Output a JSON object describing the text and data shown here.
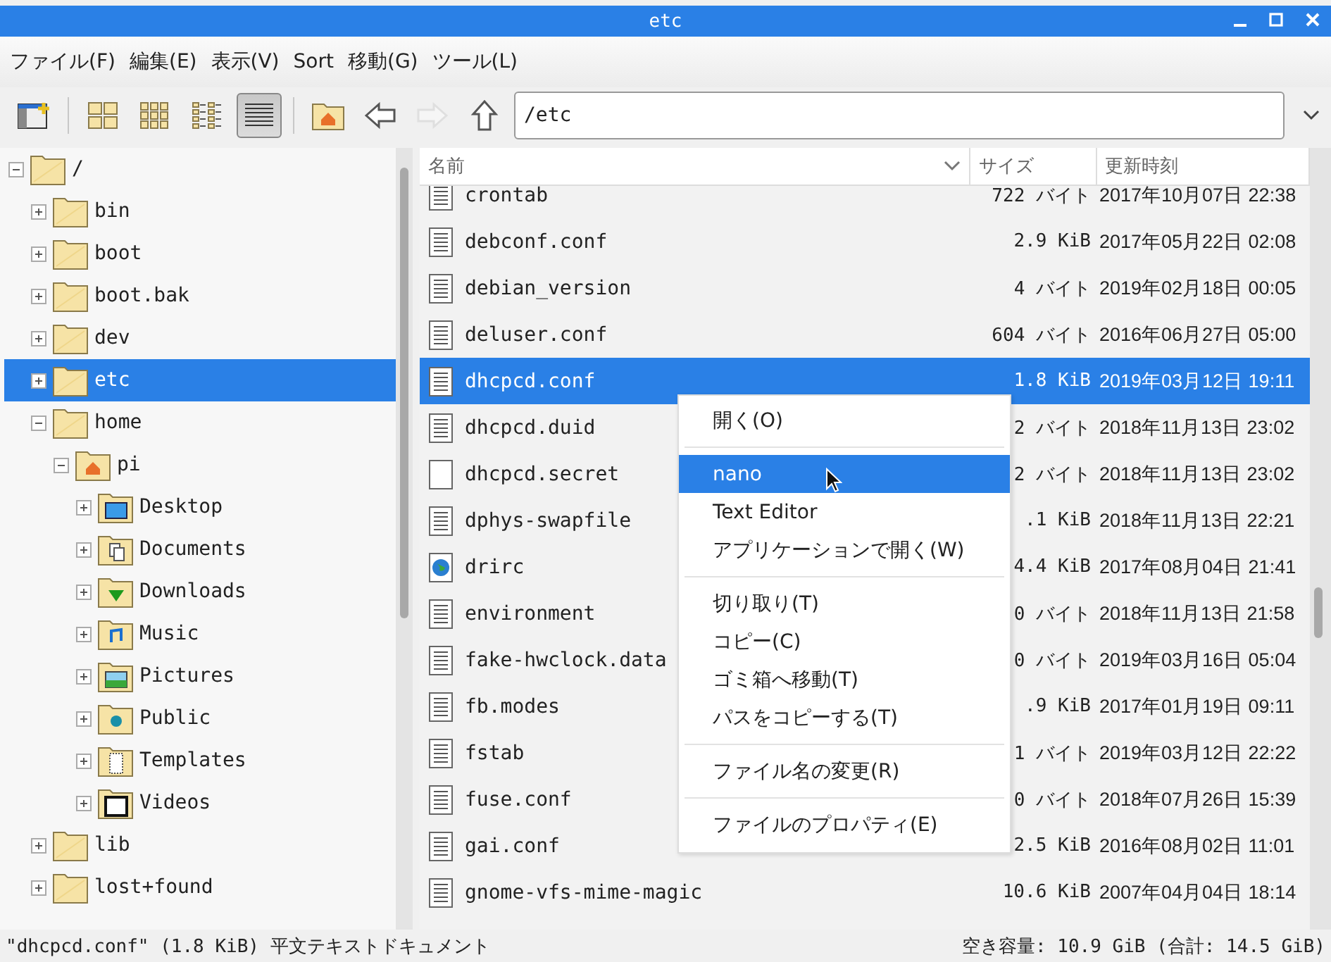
{
  "window": {
    "title": "etc"
  },
  "menubar": [
    "ファイル(F)",
    "編集(E)",
    "表示(V)",
    "Sort",
    "移動(G)",
    "ツール(L)"
  ],
  "toolbar": {
    "buttons": [
      {
        "kind": "new-window",
        "selected": false,
        "disabled": false
      },
      {
        "kind": "sep"
      },
      {
        "kind": "icons",
        "selected": false,
        "disabled": false
      },
      {
        "kind": "thumbs",
        "selected": false,
        "disabled": false
      },
      {
        "kind": "compact",
        "selected": false,
        "disabled": false
      },
      {
        "kind": "list",
        "selected": true,
        "disabled": false
      },
      {
        "kind": "sep"
      },
      {
        "kind": "home",
        "selected": false,
        "disabled": false
      },
      {
        "kind": "back",
        "selected": false,
        "disabled": false
      },
      {
        "kind": "forward",
        "selected": false,
        "disabled": true
      },
      {
        "kind": "up",
        "selected": false,
        "disabled": false
      }
    ],
    "path": "/etc"
  },
  "tree": [
    {
      "label": "/",
      "kind": "folder",
      "expanded": true,
      "selected": false,
      "children": [
        {
          "label": "bin",
          "kind": "folder",
          "expanded": false,
          "selected": false
        },
        {
          "label": "boot",
          "kind": "folder",
          "expanded": false,
          "selected": false
        },
        {
          "label": "boot.bak",
          "kind": "folder",
          "expanded": false,
          "selected": false
        },
        {
          "label": "dev",
          "kind": "folder",
          "expanded": false,
          "selected": false
        },
        {
          "label": "etc",
          "kind": "folder",
          "expanded": false,
          "selected": true
        },
        {
          "label": "home",
          "kind": "folder",
          "expanded": true,
          "selected": false,
          "children": [
            {
              "label": "pi",
              "kind": "home",
              "expanded": true,
              "selected": false,
              "children": [
                {
                  "label": "Desktop",
                  "kind": "desktop",
                  "expanded": false,
                  "selected": false
                },
                {
                  "label": "Documents",
                  "kind": "documents",
                  "expanded": false,
                  "selected": false
                },
                {
                  "label": "Downloads",
                  "kind": "downloads",
                  "expanded": false,
                  "selected": false
                },
                {
                  "label": "Music",
                  "kind": "music",
                  "expanded": false,
                  "selected": false
                },
                {
                  "label": "Pictures",
                  "kind": "pictures",
                  "expanded": false,
                  "selected": false
                },
                {
                  "label": "Public",
                  "kind": "public",
                  "expanded": false,
                  "selected": false
                },
                {
                  "label": "Templates",
                  "kind": "templates",
                  "expanded": false,
                  "selected": false
                },
                {
                  "label": "Videos",
                  "kind": "videos",
                  "expanded": false,
                  "selected": false
                }
              ]
            }
          ]
        },
        {
          "label": "lib",
          "kind": "folder",
          "expanded": false,
          "selected": false
        },
        {
          "label": "lost+found",
          "kind": "folder",
          "expanded": false,
          "selected": false
        }
      ]
    }
  ],
  "columns": [
    "名前",
    "サイズ",
    "更新時刻"
  ],
  "files": [
    {
      "name": "crontab",
      "kind": "text",
      "size": "722 バイト",
      "modified": "2017年10月07日 22:38",
      "selected": false
    },
    {
      "name": "debconf.conf",
      "kind": "text",
      "size": "2.9 KiB",
      "modified": "2017年05月22日 02:08",
      "selected": false
    },
    {
      "name": "debian_version",
      "kind": "text",
      "size": "4 バイト",
      "modified": "2019年02月18日 00:05",
      "selected": false
    },
    {
      "name": "deluser.conf",
      "kind": "text",
      "size": "604 バイト",
      "modified": "2016年06月27日 05:00",
      "selected": false
    },
    {
      "name": "dhcpcd.conf",
      "kind": "text",
      "size": "1.8 KiB",
      "modified": "2019年03月12日 19:11",
      "selected": true
    },
    {
      "name": "dhcpcd.duid",
      "kind": "text",
      "size": "2 バイト",
      "modified": "2018年11月13日 23:02",
      "selected": false
    },
    {
      "name": "dhcpcd.secret",
      "kind": "blank",
      "size": "2 バイト",
      "modified": "2018年11月13日 23:02",
      "selected": false
    },
    {
      "name": "dphys-swapfile",
      "kind": "text",
      "size": ".1 KiB",
      "modified": "2018年11月13日 22:21",
      "selected": false
    },
    {
      "name": "drirc",
      "kind": "globe",
      "size": "4.4 KiB",
      "modified": "2017年08月04日 21:41",
      "selected": false
    },
    {
      "name": "environment",
      "kind": "text",
      "size": "0 バイト",
      "modified": "2018年11月13日 21:58",
      "selected": false
    },
    {
      "name": "fake-hwclock.data",
      "kind": "text",
      "size": "0 バイト",
      "modified": "2019年03月16日 05:04",
      "selected": false
    },
    {
      "name": "fb.modes",
      "kind": "text",
      "size": ".9 KiB",
      "modified": "2017年01月19日 09:11",
      "selected": false
    },
    {
      "name": "fstab",
      "kind": "text",
      "size": "1 バイト",
      "modified": "2019年03月12日 22:22",
      "selected": false
    },
    {
      "name": "fuse.conf",
      "kind": "text",
      "size": "0 バイト",
      "modified": "2018年07月26日 15:39",
      "selected": false
    },
    {
      "name": "gai.conf",
      "kind": "text",
      "size": "2.5 KiB",
      "modified": "2016年08月02日 11:01",
      "selected": false
    },
    {
      "name": "gnome-vfs-mime-magic",
      "kind": "text",
      "size": "10.6 KiB",
      "modified": "2007年04月04日 18:14",
      "selected": false
    }
  ],
  "context_menu": [
    {
      "kind": "item",
      "label": "開く(O)",
      "selected": false
    },
    {
      "kind": "separator"
    },
    {
      "kind": "item",
      "label": "nano",
      "selected": true
    },
    {
      "kind": "item",
      "label": "Text Editor",
      "selected": false
    },
    {
      "kind": "item",
      "label": "アプリケーションで開く(W)",
      "selected": false
    },
    {
      "kind": "separator"
    },
    {
      "kind": "item",
      "label": "切り取り(T)",
      "selected": false
    },
    {
      "kind": "item",
      "label": "コピー(C)",
      "selected": false
    },
    {
      "kind": "item",
      "label": "ゴミ箱へ移動(T)",
      "selected": false
    },
    {
      "kind": "item",
      "label": "パスをコピーする(T)",
      "selected": false
    },
    {
      "kind": "separator"
    },
    {
      "kind": "item",
      "label": "ファイル名の変更(R)",
      "selected": false
    },
    {
      "kind": "separator"
    },
    {
      "kind": "item",
      "label": "ファイルのプロパティ(E)",
      "selected": false
    }
  ],
  "status_bar": {
    "selection": "\"dhcpcd.conf\" (1.8 KiB) 平文テキストドキュメント",
    "free_space": "空き容量: 10.9 GiB (合計: 14.5 GiB)"
  }
}
